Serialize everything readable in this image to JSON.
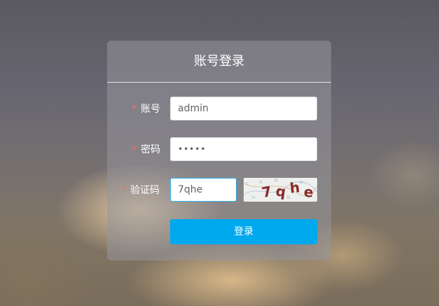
{
  "login": {
    "title": "账号登录",
    "required_mark": "*",
    "account_label": "账号",
    "account_value": "admin",
    "password_label": "密码",
    "password_value": "•••••",
    "captcha_label": "验证码",
    "captcha_value": "7qhe",
    "captcha_image_text": [
      "7",
      "q",
      "h",
      "e"
    ],
    "login_button": "登录"
  }
}
